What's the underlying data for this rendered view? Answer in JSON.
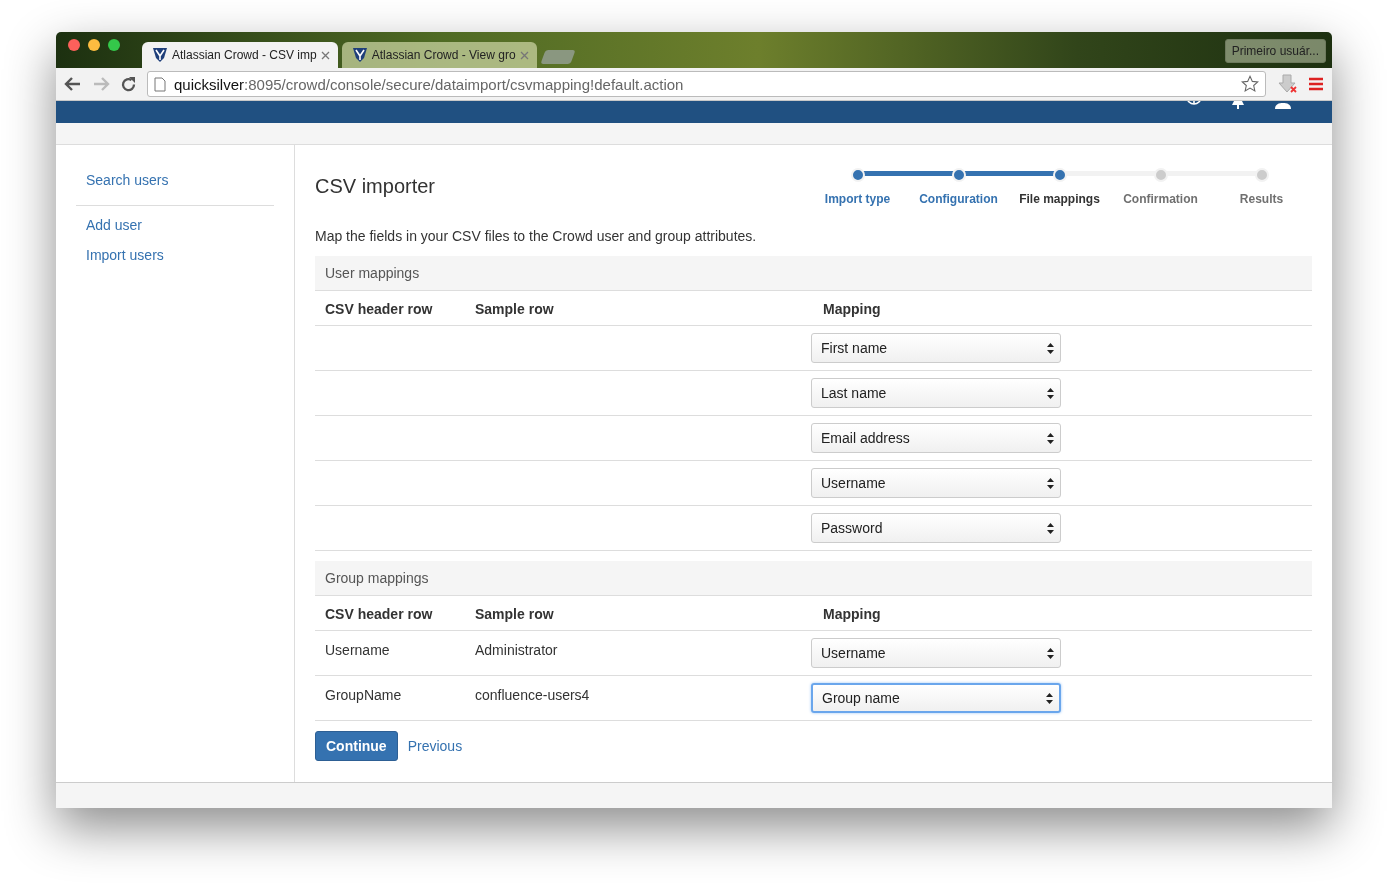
{
  "browser": {
    "tabs": [
      {
        "title": "Atlassian Crowd - CSV imp",
        "selected": true
      },
      {
        "title": "Atlassian Crowd - View gro",
        "selected": false
      }
    ],
    "profile": "Primeiro usuár...",
    "address": {
      "host": "quicksilver",
      "path": ":8095/crowd/console/secure/dataimport/csvmapping!default.action"
    }
  },
  "sidebar": {
    "groups": [
      [
        "Search users"
      ],
      [
        "Add user",
        "Import users"
      ]
    ]
  },
  "heading": "CSV importer",
  "steps": [
    {
      "label": "Import type",
      "done": true,
      "selected": false
    },
    {
      "label": "Configuration",
      "done": true,
      "selected": false
    },
    {
      "label": "File mappings",
      "done": true,
      "selected": true
    },
    {
      "label": "Confirmation",
      "done": false,
      "selected": false
    },
    {
      "label": "Results",
      "done": false,
      "selected": false
    }
  ],
  "description": "Map the fields in your CSV files to the Crowd user and group attributes.",
  "sections": [
    {
      "title": "User mappings",
      "columns": [
        "CSV header row",
        "Sample row",
        "Mapping"
      ],
      "rows": [
        {
          "mapping": "First name",
          "focused": false
        },
        {
          "mapping": "Last name",
          "focused": false
        },
        {
          "mapping": "Email address",
          "focused": false
        },
        {
          "mapping": "Username",
          "focused": false
        },
        {
          "mapping": "Password",
          "focused": false
        }
      ]
    },
    {
      "title": "Group mappings",
      "columns": [
        "CSV header row",
        "Sample row",
        "Mapping"
      ],
      "rows": [
        {
          "header": "Username",
          "sample": "Administrator",
          "mapping": "Username",
          "focused": false
        },
        {
          "header": "GroupName",
          "sample": "confluence-users4",
          "mapping": "Group name",
          "focused": true
        }
      ]
    }
  ],
  "buttons": {
    "continue": "Continue",
    "previous": "Previous"
  }
}
